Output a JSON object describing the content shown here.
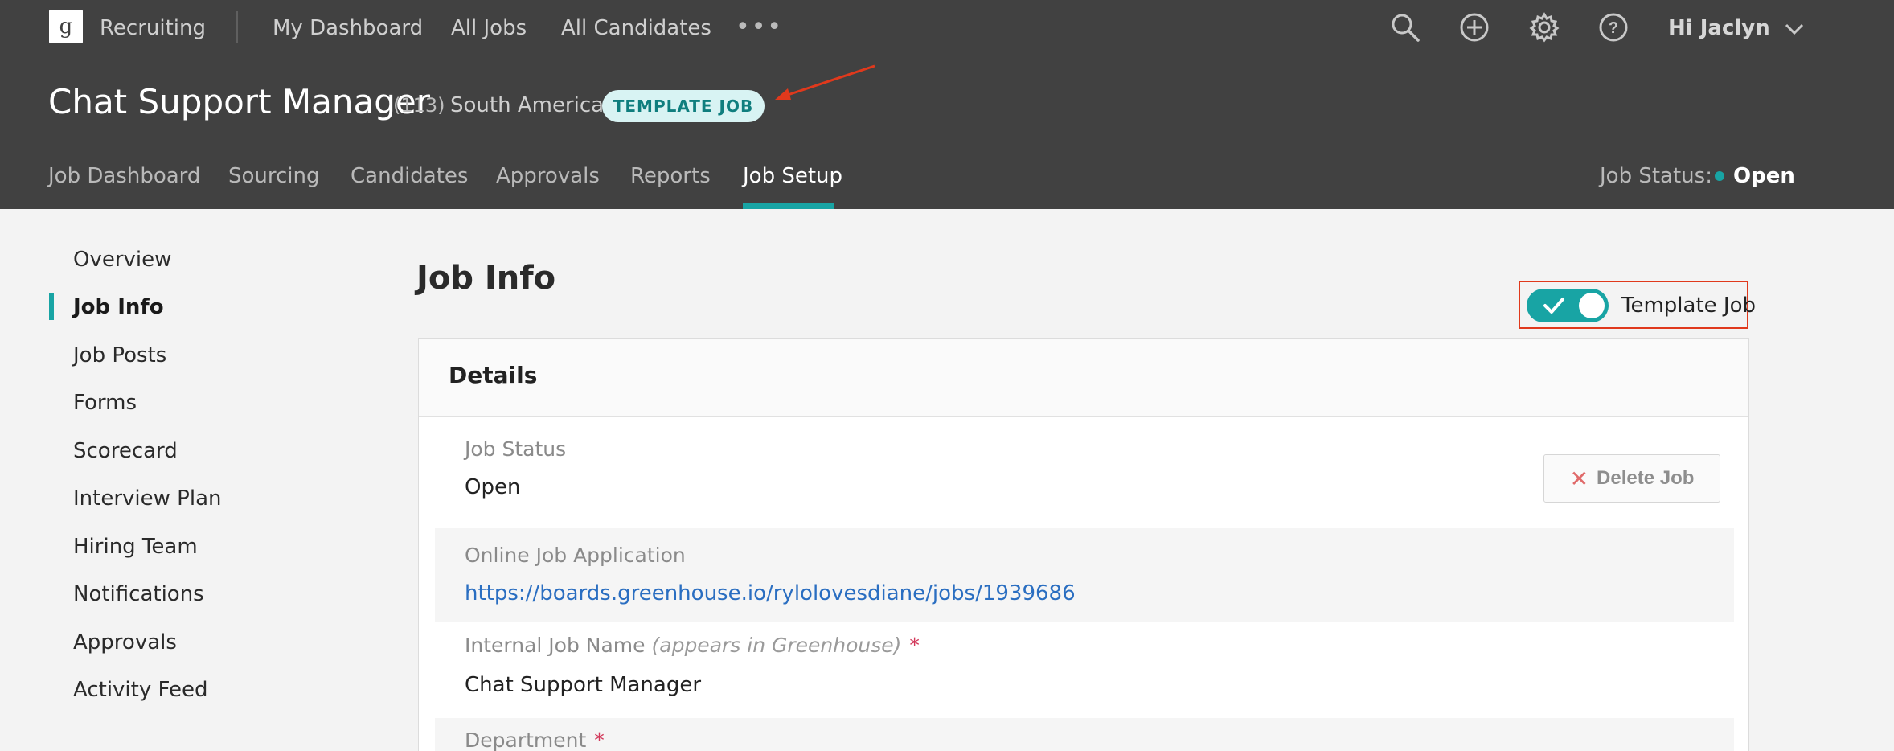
{
  "topnav": {
    "logo_glyph": "g",
    "app_name": "Recruiting",
    "items": [
      "My Dashboard",
      "All Jobs",
      "All Candidates"
    ],
    "more": "•••",
    "greeting": "Hi Jaclyn"
  },
  "job": {
    "title": "Chat Support Manager",
    "count": "(113)",
    "location": "South America",
    "badge": "TEMPLATE JOB"
  },
  "subnav": {
    "tabs": [
      "Job Dashboard",
      "Sourcing",
      "Candidates",
      "Approvals",
      "Reports",
      "Job Setup"
    ],
    "active": "Job Setup",
    "status_label": "Job Status:",
    "status_value": "Open"
  },
  "sidebar": {
    "items": [
      "Overview",
      "Job Info",
      "Job Posts",
      "Forms",
      "Scorecard",
      "Interview Plan",
      "Hiring Team",
      "Notifications",
      "Approvals",
      "Activity Feed"
    ],
    "active": "Job Info"
  },
  "main": {
    "heading": "Job Info",
    "template_toggle": {
      "label": "Template Job",
      "on": true
    },
    "details": {
      "title": "Details",
      "delete_label": "Delete Job",
      "fields": {
        "job_status": {
          "label": "Job Status",
          "value": "Open"
        },
        "online_app": {
          "label": "Online Job Application",
          "value": "https://boards.greenhouse.io/rylolovesdiane/jobs/1939686"
        },
        "internal_name": {
          "label": "Internal Job Name",
          "hint": "(appears in Greenhouse)",
          "value": "Chat Support Manager"
        },
        "department": {
          "label": "Department"
        }
      },
      "required_mark": "*"
    }
  },
  "colors": {
    "header_bg": "#414141",
    "accent": "#18a4a4",
    "badge_bg": "#d8f3f3",
    "annotation_red": "#e0391c",
    "link": "#2a6ec1"
  }
}
